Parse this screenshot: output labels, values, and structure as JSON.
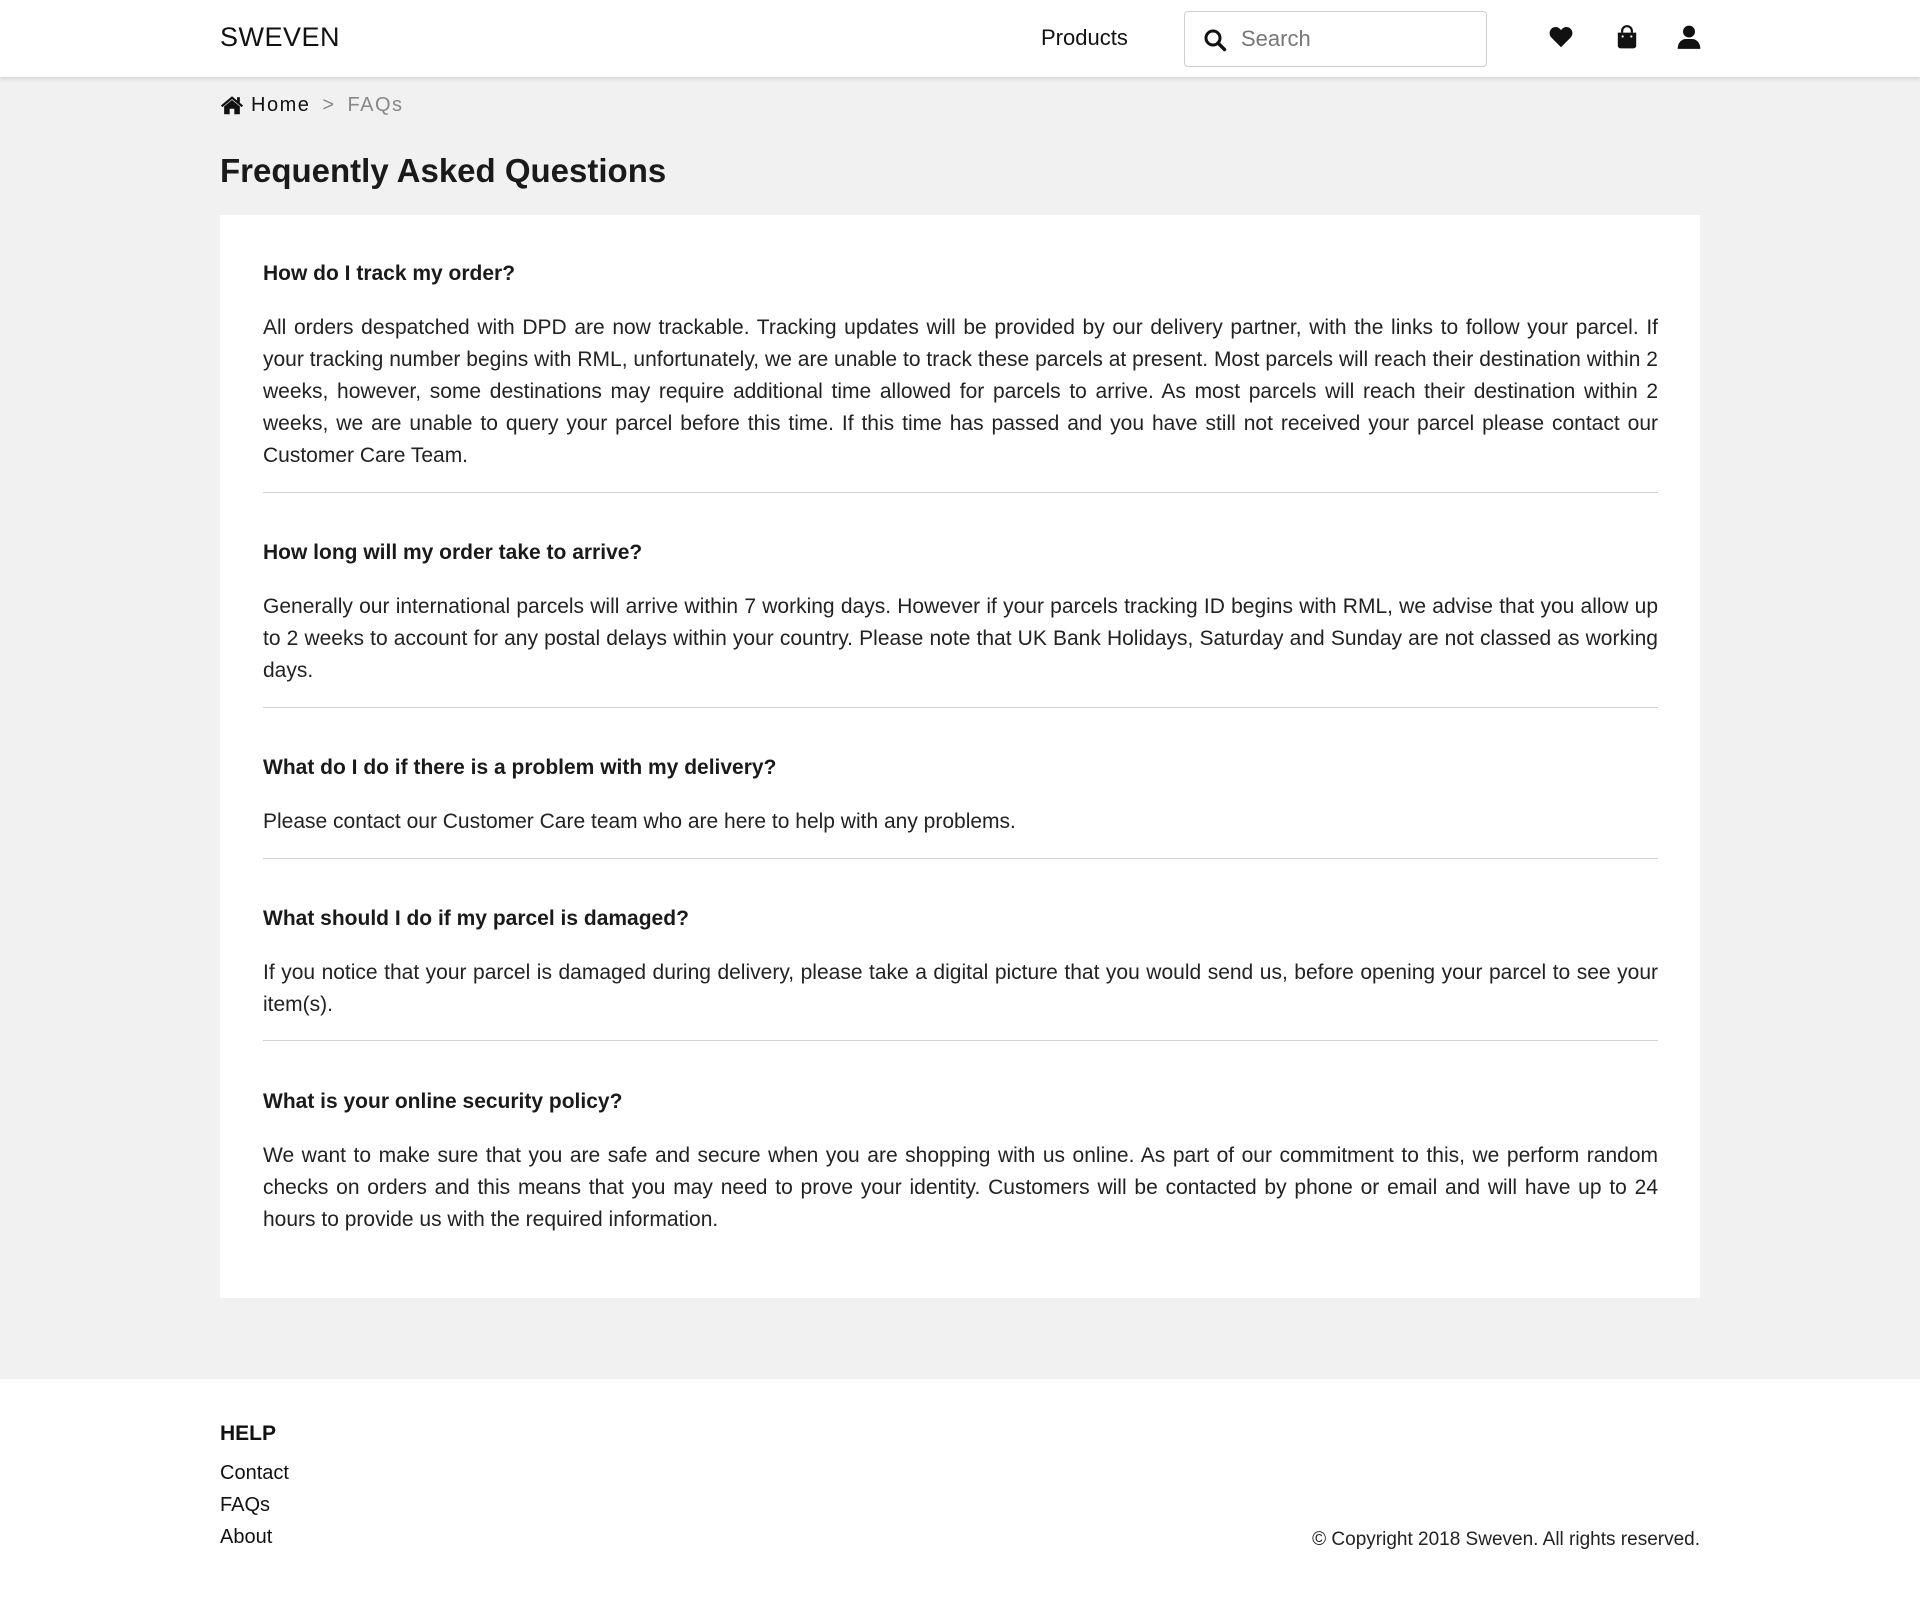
{
  "header": {
    "brand": "SWEVEN",
    "nav_products": "Products",
    "search_placeholder": "Search",
    "icons": [
      "heart-icon",
      "shopping-bag-icon",
      "user-icon"
    ]
  },
  "breadcrumb": {
    "home": "Home",
    "separator": ">",
    "current": "FAQs"
  },
  "page_title": "Frequently Asked Questions",
  "faqs": [
    {
      "question": "How do I track my order?",
      "answer": "All orders despatched with DPD are now trackable. Tracking updates will be provided by our delivery partner, with the links to follow your parcel. If your tracking number begins with RML, unfortunately, we are unable to track these parcels at present. Most parcels will reach their destination within 2 weeks, however, some destinations may require additional time allowed for parcels to arrive. As most parcels will reach their destination within 2 weeks, we are unable to query your parcel before this time. If this time has passed and you have still not received your parcel please contact our Customer Care Team."
    },
    {
      "question": "How long will my order take to arrive?",
      "answer": "Generally our international parcels will arrive within 7 working days. However if your parcels tracking ID begins with RML, we advise that you allow up to 2 weeks to account for any postal delays within your country. Please note that UK Bank Holidays, Saturday and Sunday are not classed as working days."
    },
    {
      "question": "What do I do if there is a problem with my delivery?",
      "answer": "Please contact our Customer Care team who are here to help with any problems."
    },
    {
      "question": "What should I do if my parcel is damaged?",
      "answer": "If you notice that your parcel is damaged during delivery, please take a digital picture that you would send us, before opening your parcel to see your item(s)."
    },
    {
      "question": "What is your online security policy?",
      "answer": "We want to make sure that you are safe and secure when you are shopping with us online. As part of our commitment to this, we perform random checks on orders and this means that you may need to prove your identity. Customers will be contacted by phone or email and will have up to 24 hours to provide us with the required information."
    }
  ],
  "footer": {
    "heading": "HELP",
    "links": [
      "Contact",
      "FAQs",
      "About"
    ],
    "copyright": "© Copyright 2018 Sweven. All rights reserved."
  }
}
